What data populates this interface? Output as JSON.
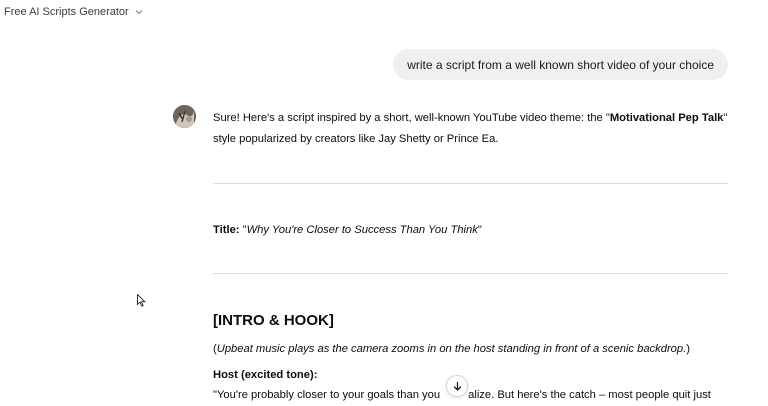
{
  "header": {
    "title": "Free AI Scripts Generator",
    "dropdown_icon": "chevron-down-icon"
  },
  "user_message": "write a script from a well known short video of your choice",
  "assistant": {
    "intro_prefix": "Sure! Here's a script inspired by a short, well-known YouTube video theme: the \"",
    "intro_bold": "Motivational Pep Talk",
    "intro_suffix": "\" style popularized by creators like Jay Shetty or Prince Ea.",
    "title_label": "Title:",
    "title_open": " \"",
    "title_italic": "Why You're Closer to Success Than You Think",
    "title_close": "\"",
    "section_heading": "[INTRO & HOOK]",
    "stage_open": "(",
    "stage_direction": "Upbeat music plays as the camera zooms in on the host standing in front of a scenic backdrop.",
    "stage_close": ")",
    "host_label": "Host (excited tone):",
    "quote_start": "\"You're probably closer to your goals than you",
    "quote_end": "alize. But here's the catch – most people quit just"
  },
  "icons": {
    "scroll_down": "arrow-down-icon",
    "cursor": "mouse-cursor-icon",
    "avatar": "assistant-avatar"
  }
}
